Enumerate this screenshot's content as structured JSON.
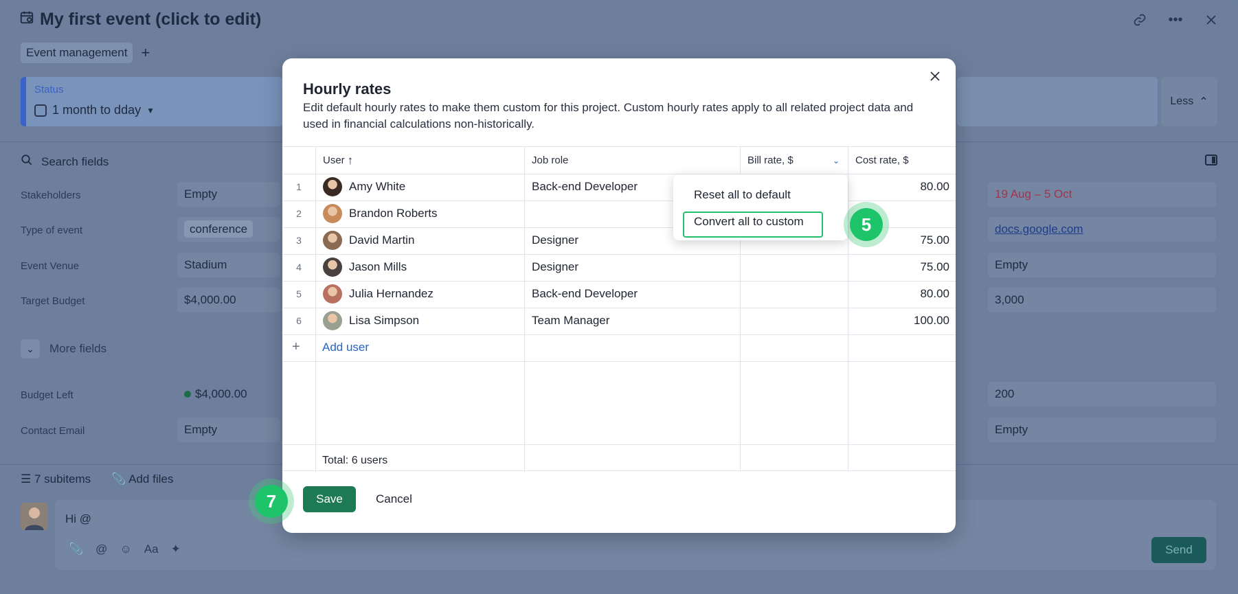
{
  "app": {
    "title": "My first event (click to edit)",
    "tag": "Event management",
    "status_label": "Status",
    "status_value": "1 month to dday",
    "less_label": "Less",
    "search_placeholder": "Search fields",
    "more_fields": "More fields",
    "fields_left": [
      {
        "label": "Stakeholders",
        "value": "Empty"
      },
      {
        "label": "Type of event",
        "value": "conference"
      },
      {
        "label": "Event Venue",
        "value": "Stadium"
      },
      {
        "label": "Target Budget",
        "value": "$4,000.00"
      },
      {
        "label": "Budget Left",
        "value": "$4,000.00"
      },
      {
        "label": "Contact Email",
        "value": "Empty"
      }
    ],
    "fields_right": [
      {
        "value": "19 Aug – 5 Oct"
      },
      {
        "value": "docs.google.com"
      },
      {
        "value": "Empty"
      },
      {
        "value": "3,000"
      },
      {
        "value": "200"
      },
      {
        "value": "Empty"
      }
    ],
    "subitems": "7 subitems",
    "add_files": "Add files",
    "comment_text": "Hi @",
    "send_label": "Send"
  },
  "modal": {
    "title": "Hourly rates",
    "description": "Edit default hourly rates to make them custom for this project. Custom hourly rates apply to all related project data and used in financial calculations non-historically.",
    "columns": {
      "user": "User",
      "job_role": "Job role",
      "bill_rate": "Bill rate, $",
      "cost_rate": "Cost rate, $"
    },
    "rows": [
      {
        "num": "1",
        "user": "Amy White",
        "job_role": "Back-end Developer",
        "cost_rate": "80.00"
      },
      {
        "num": "2",
        "user": "Brandon Roberts",
        "job_role": "",
        "cost_rate": ""
      },
      {
        "num": "3",
        "user": "David Martin",
        "job_role": "Designer",
        "cost_rate": "75.00"
      },
      {
        "num": "4",
        "user": "Jason Mills",
        "job_role": "Designer",
        "cost_rate": "75.00"
      },
      {
        "num": "5",
        "user": "Julia Hernandez",
        "job_role": "Back-end Developer",
        "cost_rate": "80.00"
      },
      {
        "num": "6",
        "user": "Lisa Simpson",
        "job_role": "Team Manager",
        "cost_rate": "100.00"
      }
    ],
    "add_user": "Add user",
    "total": "Total: 6 users",
    "save_label": "Save",
    "cancel_label": "Cancel"
  },
  "dropdown": {
    "items": [
      "Reset all to default",
      "Convert all to custom"
    ]
  },
  "steps": {
    "step_a": "5",
    "step_b": "7"
  },
  "colors": {
    "accent": "#1e7a52",
    "step": "#1ec46a",
    "link": "#2563c8"
  }
}
